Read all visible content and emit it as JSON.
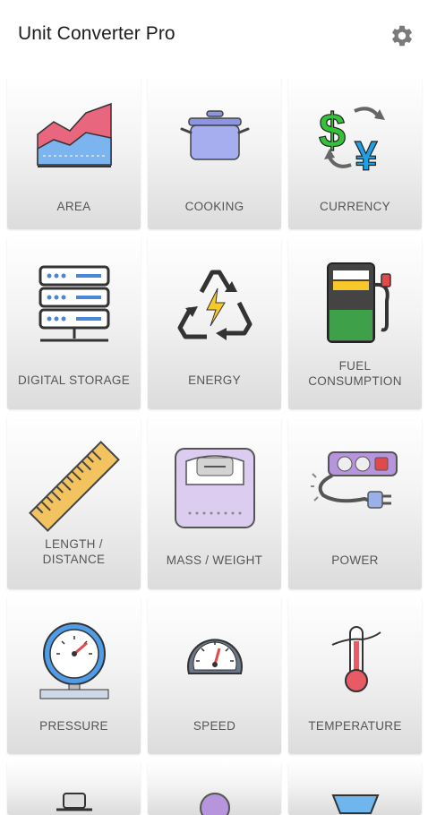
{
  "app": {
    "title": "Unit Converter Pro"
  },
  "icons": {
    "settings": "gear-icon"
  },
  "categories": [
    {
      "label": "AREA",
      "icon": "area-chart-icon"
    },
    {
      "label": "COOKING",
      "icon": "cooking-pot-icon"
    },
    {
      "label": "CURRENCY",
      "icon": "currency-exchange-icon"
    },
    {
      "label": "DIGITAL STORAGE",
      "icon": "server-storage-icon"
    },
    {
      "label": "ENERGY",
      "icon": "energy-recycle-icon"
    },
    {
      "label": "FUEL\nCONSUMPTION",
      "icon": "fuel-pump-icon"
    },
    {
      "label": "LENGTH /\nDISTANCE",
      "icon": "ruler-icon"
    },
    {
      "label": "MASS / WEIGHT",
      "icon": "weighing-scale-icon"
    },
    {
      "label": "POWER",
      "icon": "power-strip-icon"
    },
    {
      "label": "PRESSURE",
      "icon": "pressure-gauge-icon"
    },
    {
      "label": "SPEED",
      "icon": "speedometer-icon"
    },
    {
      "label": "TEMPERATURE",
      "icon": "thermometer-icon"
    }
  ],
  "colors": {
    "chart_pink": "#e9667f",
    "chart_blue": "#7cb4ef",
    "pot_lilac": "#8c95df",
    "currency_green": "#33c33a",
    "currency_blue": "#1fa0e3",
    "fuel_yellow": "#f8c72a",
    "fuel_green": "#3ea14a",
    "ruler_yellow": "#f3c35f",
    "scale_lavender": "#dcccf0",
    "power_purple": "#b695dc",
    "gauge_blue": "#4f9ce8",
    "thermo_red": "#e85a64"
  }
}
